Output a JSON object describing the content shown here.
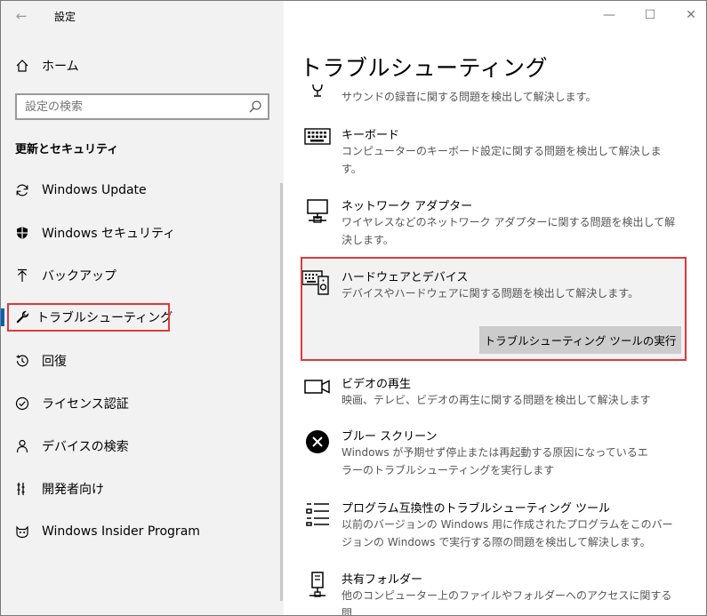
{
  "app": {
    "title": "設定"
  },
  "sidebar": {
    "home_label": "ホーム",
    "search_placeholder": "設定の検索",
    "section_title": "更新とセキュリティ",
    "items": [
      {
        "label": "Windows Update",
        "icon": "refresh-icon"
      },
      {
        "label": "Windows セキュリティ",
        "icon": "shield-icon"
      },
      {
        "label": "バックアップ",
        "icon": "upload-icon"
      },
      {
        "label": "トラブルシューティング",
        "icon": "wrench-icon",
        "selected": true
      },
      {
        "label": "回復",
        "icon": "history-icon"
      },
      {
        "label": "ライセンス認証",
        "icon": "check-circle-icon"
      },
      {
        "label": "デバイスの検索",
        "icon": "person-location-icon"
      },
      {
        "label": "開発者向け",
        "icon": "developer-icon"
      },
      {
        "label": "Windows Insider Program",
        "icon": "insider-cat-icon"
      }
    ]
  },
  "main": {
    "title": "トラブルシューティング",
    "items": [
      {
        "title": "",
        "desc": "サウンドの録音に関する問題を検出して解決します。",
        "icon": "microphone-icon"
      },
      {
        "title": "キーボード",
        "desc": "コンピューターのキーボード設定に関する問題を検出して解決しま\nす。",
        "icon": "keyboard-icon"
      },
      {
        "title": "ネットワーク アダプター",
        "desc": "ワイヤレスなどのネットワーク アダプターに関する問題を検出して解\n決します。",
        "icon": "network-icon"
      },
      {
        "title": "ハードウェアとデバイス",
        "desc": "デバイスやハードウェアに関する問題を検出して解決します。",
        "icon": "hardware-icon",
        "expanded": true
      },
      {
        "title": "ビデオの再生",
        "desc": "映画、テレビ、ビデオの再生に関する問題を検出して解決します",
        "icon": "video-icon"
      },
      {
        "title": "ブルー スクリーン",
        "desc": "Windows が予期せず停止または再起動する原因になっているエ\nラーのトラブルシューティングを実行します",
        "icon": "error-circle-icon"
      },
      {
        "title": "プログラム互換性のトラブルシューティング ツール",
        "desc": "以前のバージョンの Windows 用に作成されたプログラムをこのバー\nジョンの Windows で実行する際の問題を検出して解決します。",
        "icon": "list-icon"
      },
      {
        "title": "共有フォルダー",
        "desc": "他のコンピューター上のファイルやフォルダーへのアクセスに関する問\n題を検出して解決します。",
        "icon": "shared-folder-icon"
      }
    ],
    "run_button": "トラブルシューティング ツールの実行"
  },
  "colors": {
    "highlight": "#e0383e",
    "accent": "#0063b1",
    "sidebar_bg": "#f2f2f2"
  }
}
